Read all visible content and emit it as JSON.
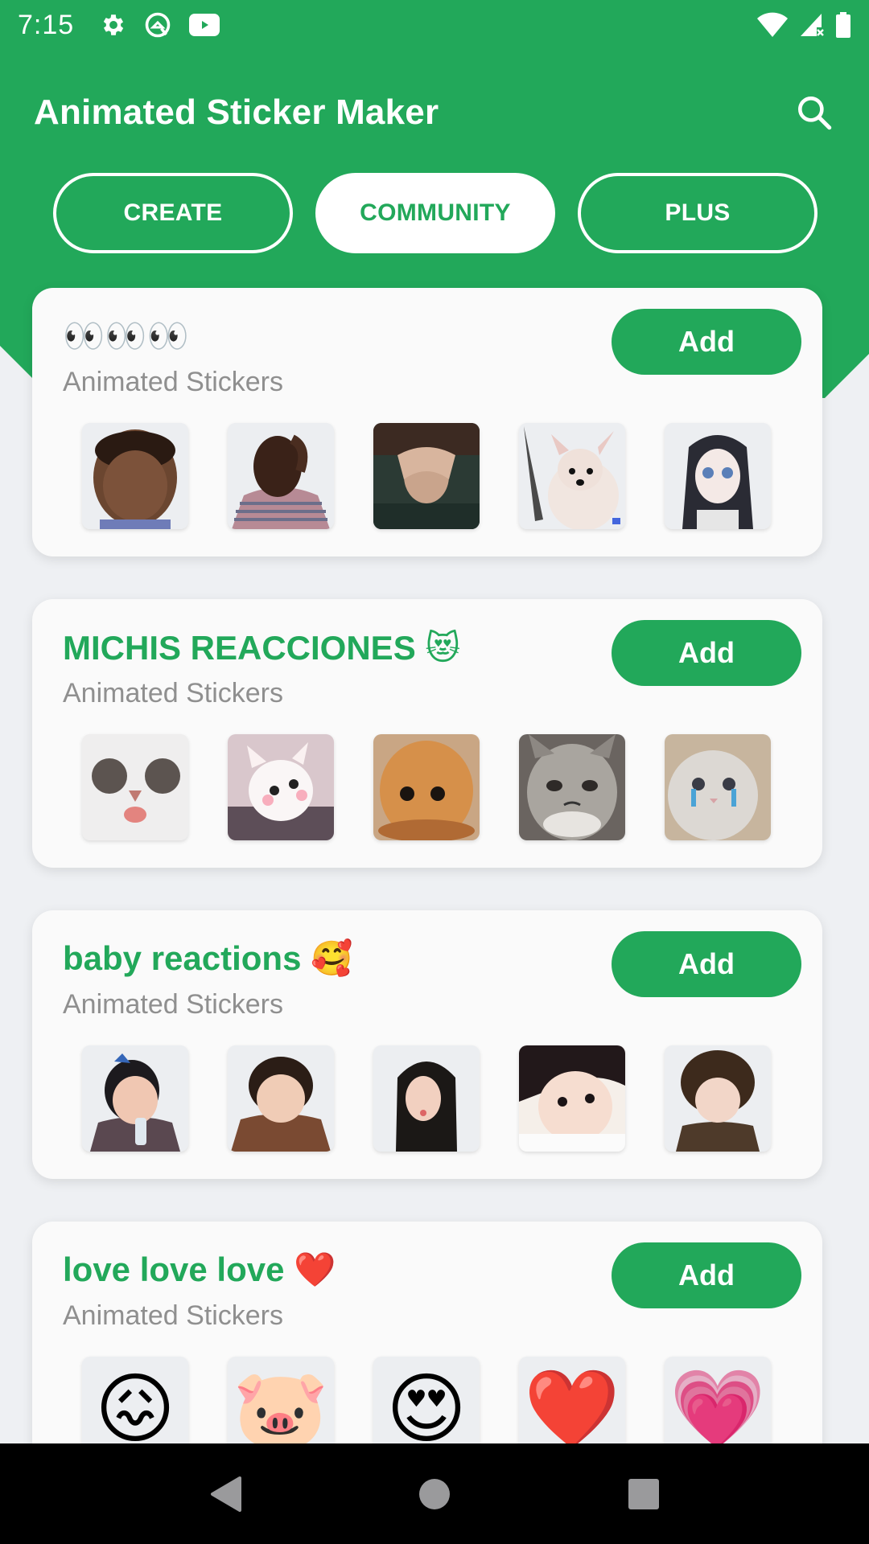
{
  "status_bar": {
    "time": "7:15",
    "left_icons": [
      "settings-icon",
      "android-q-icon",
      "youtube-icon"
    ],
    "right_icons": [
      "wifi-icon",
      "signal-no-service-icon",
      "battery-icon"
    ]
  },
  "app_bar": {
    "title": "Animated Sticker Maker",
    "search_icon": "search-icon"
  },
  "tabs": [
    {
      "label": "CREATE",
      "active": false
    },
    {
      "label": "COMMUNITY",
      "active": true
    },
    {
      "label": "PLUS",
      "active": false
    }
  ],
  "colors": {
    "brand_green": "#22a85a",
    "background": "#eef0f3",
    "subtitle_gray": "#8f8f8f"
  },
  "packs": [
    {
      "title": "👀👀👀",
      "subtitle": "Animated Stickers",
      "add_label": "Add",
      "stickers": [
        "boy-face-sticker",
        "crying-man-sticker",
        "woman-hands-head-sticker",
        "dog-knife-sticker",
        "anime-girl-sticker"
      ]
    },
    {
      "title": "MICHIS REACCIONES 😻",
      "subtitle": "Animated Stickers",
      "add_label": "Add",
      "stickers": [
        "cat-tongue-sticker",
        "white-cat-blush-sticker",
        "orange-cat-sticker",
        "grumpy-cat-sticker",
        "crying-cat-sticker"
      ]
    },
    {
      "title": "baby reactions 🥰",
      "subtitle": "Animated Stickers",
      "add_label": "Add",
      "stickers": [
        "baby-drinking-sticker",
        "baby-smiling-sticker",
        "girl-long-hair-sticker",
        "baby-resting-sticker",
        "curly-toddler-sticker"
      ]
    },
    {
      "title": "love love love ❤️",
      "subtitle": "Animated Stickers",
      "add_label": "Add",
      "stickers": [
        "😖",
        "🐷",
        "😍",
        "❤️",
        "💗"
      ]
    }
  ],
  "nav_bar": {
    "back": "back-icon",
    "home": "home-icon",
    "recents": "recents-icon"
  }
}
